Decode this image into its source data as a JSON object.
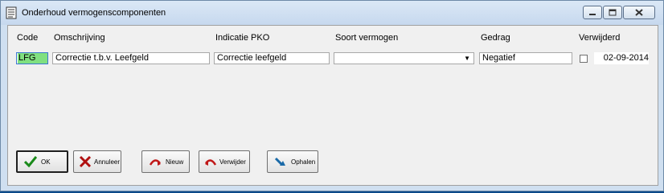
{
  "window": {
    "title": "Onderhoud vermogenscomponenten"
  },
  "columns": {
    "code": "Code",
    "omschrijving": "Omschrijving",
    "indicatie_pko": "Indicatie PKO",
    "soort_vermogen": "Soort vermogen",
    "gedrag": "Gedrag",
    "verwijderd": "Verwijderd"
  },
  "row": {
    "code": "LFG",
    "omschrijving": "Correctie t.b.v. Leefgeld",
    "indicatie_pko": "Correctie leefgeld",
    "soort_vermogen": "",
    "gedrag": "Negatief",
    "verwijderd": false,
    "datum": "02-09-2014"
  },
  "buttons": {
    "ok": "OK",
    "annuleer": "Annuleer",
    "nieuw": "Nieuw",
    "verwijder": "Verwijder",
    "ophalen": "Ophalen"
  },
  "colors": {
    "selection": "#80e080",
    "focus_border": "#3a77d0"
  }
}
